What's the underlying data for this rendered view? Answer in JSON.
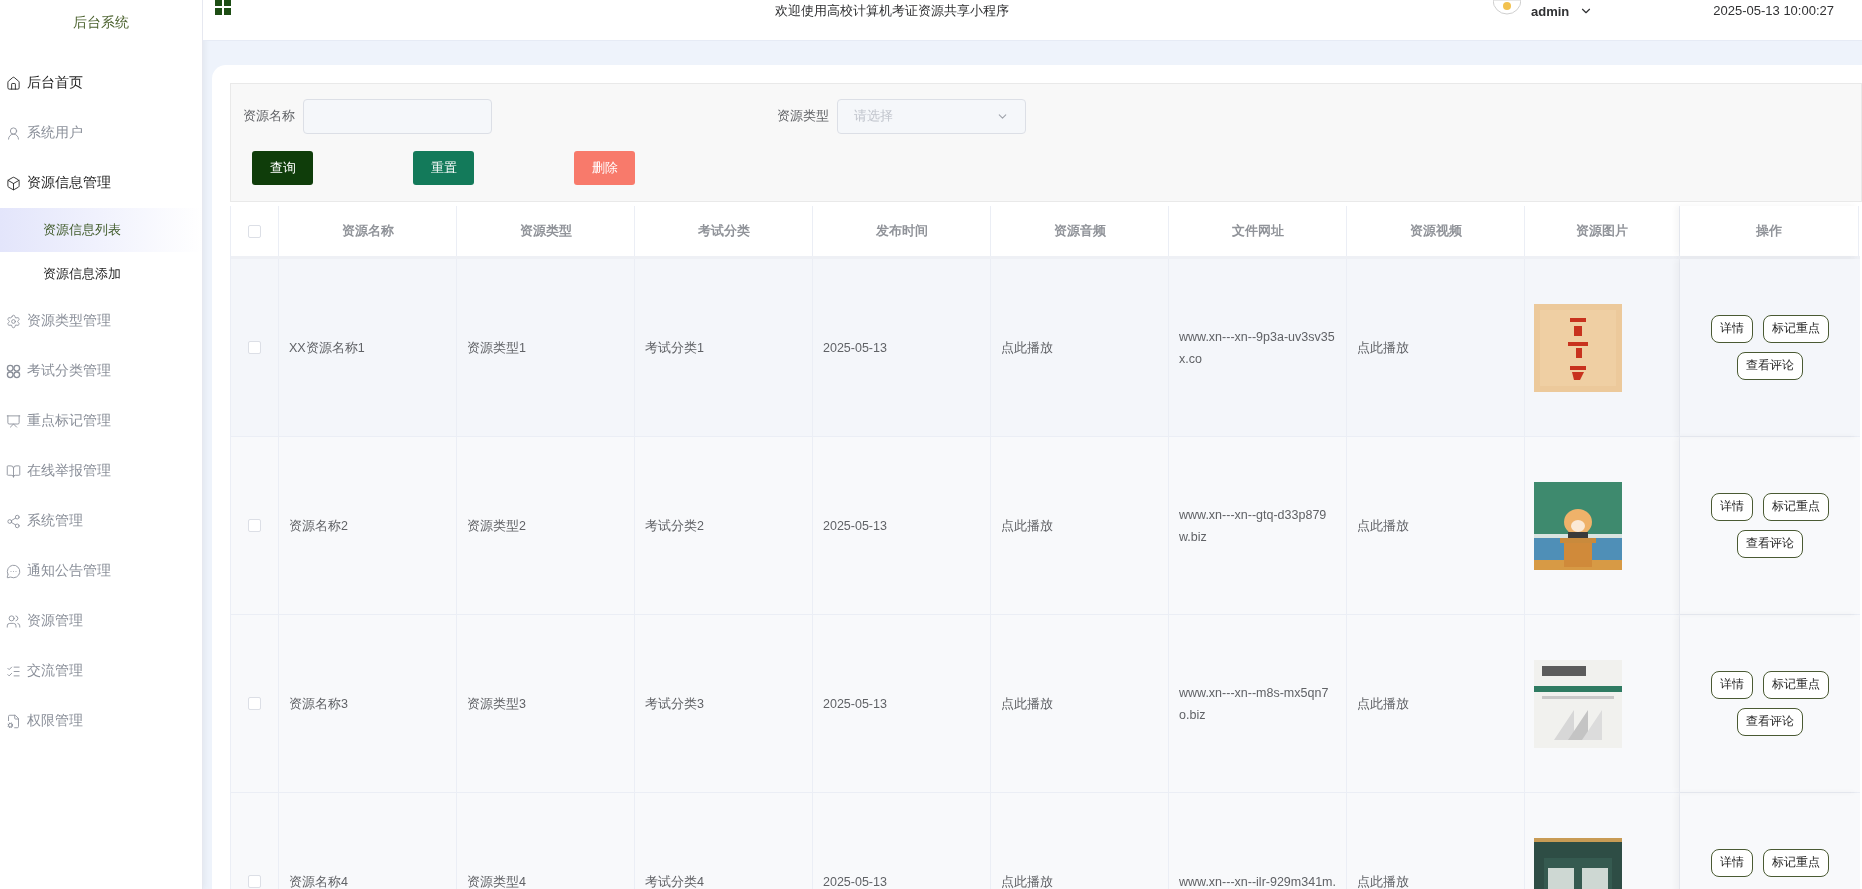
{
  "header": {
    "title": "欢迎使用高校计算机考证资源共享小程序",
    "user": "admin",
    "datetime": "2025-05-13 10:00:27"
  },
  "sidebar": {
    "title": "后台系统",
    "items": [
      {
        "label": "后台首页",
        "muted": false
      },
      {
        "label": "系统用户",
        "muted": true
      },
      {
        "label": "资源信息管理",
        "muted": false,
        "children": [
          {
            "label": "资源信息列表",
            "selected": true
          },
          {
            "label": "资源信息添加",
            "selected": false
          }
        ]
      },
      {
        "label": "资源类型管理",
        "muted": true
      },
      {
        "label": "考试分类管理",
        "muted": true
      },
      {
        "label": "重点标记管理",
        "muted": true
      },
      {
        "label": "在线举报管理",
        "muted": true
      },
      {
        "label": "系统管理",
        "muted": true
      },
      {
        "label": "通知公告管理",
        "muted": true
      },
      {
        "label": "资源管理",
        "muted": true
      },
      {
        "label": "交流管理",
        "muted": true
      },
      {
        "label": "权限管理",
        "muted": true
      }
    ]
  },
  "filters": {
    "fields": [
      {
        "kind": "input",
        "label": "资源名称"
      },
      {
        "kind": "select",
        "label": "资源类型",
        "placeholder": "请选择"
      }
    ],
    "buttons": [
      {
        "kind": "query",
        "label": "查询"
      },
      {
        "kind": "reset",
        "label": "重置"
      },
      {
        "kind": "delete",
        "label": "删除"
      }
    ]
  },
  "table": {
    "header_checkbox": {
      "checked": false
    },
    "columns": [
      "资源名称",
      "资源类型",
      "考试分类",
      "发布时间",
      "资源音频",
      "文件网址",
      "资源视频",
      "资源图片",
      "操作"
    ],
    "rows": [
      {
        "checked": false,
        "name": "XX资源名称1",
        "type": "资源类型1",
        "category": "考试分类1",
        "date": "2025-05-13",
        "audio": "点此播放",
        "url": "www.xn---xn--9p3a-uv3sv35x.co",
        "video": "点此播放",
        "image": {
          "kind": "picture"
        },
        "actions": [
          "详情",
          "标记重点",
          "查看评论"
        ]
      },
      {
        "checked": false,
        "name": "资源名称2",
        "type": "资源类型2",
        "category": "考试分类2",
        "date": "2025-05-13",
        "audio": "点此播放",
        "url": "www.xn---xn--gtq-d33p879w.biz",
        "video": "点此播放",
        "image": {
          "kind": "picture"
        },
        "actions": [
          "详情",
          "标记重点",
          "查看评论"
        ]
      },
      {
        "checked": false,
        "name": "资源名称3",
        "type": "资源类型3",
        "category": "考试分类3",
        "date": "2025-05-13",
        "audio": "点此播放",
        "url": "www.xn---xn--m8s-mx5qn7o.biz",
        "video": "点此播放",
        "image": {
          "kind": "picture"
        },
        "actions": [
          "详情",
          "标记重点",
          "查看评论"
        ]
      },
      {
        "checked": false,
        "name": "资源名称4",
        "type": "资源类型4",
        "category": "考试分类4",
        "date": "2025-05-13",
        "audio": "点此播放",
        "url": "www.xn---xn--ilr-929m341m.",
        "video": "点此播放",
        "image": {
          "kind": "picture"
        },
        "actions": [
          "详情",
          "标记重点"
        ]
      }
    ]
  }
}
